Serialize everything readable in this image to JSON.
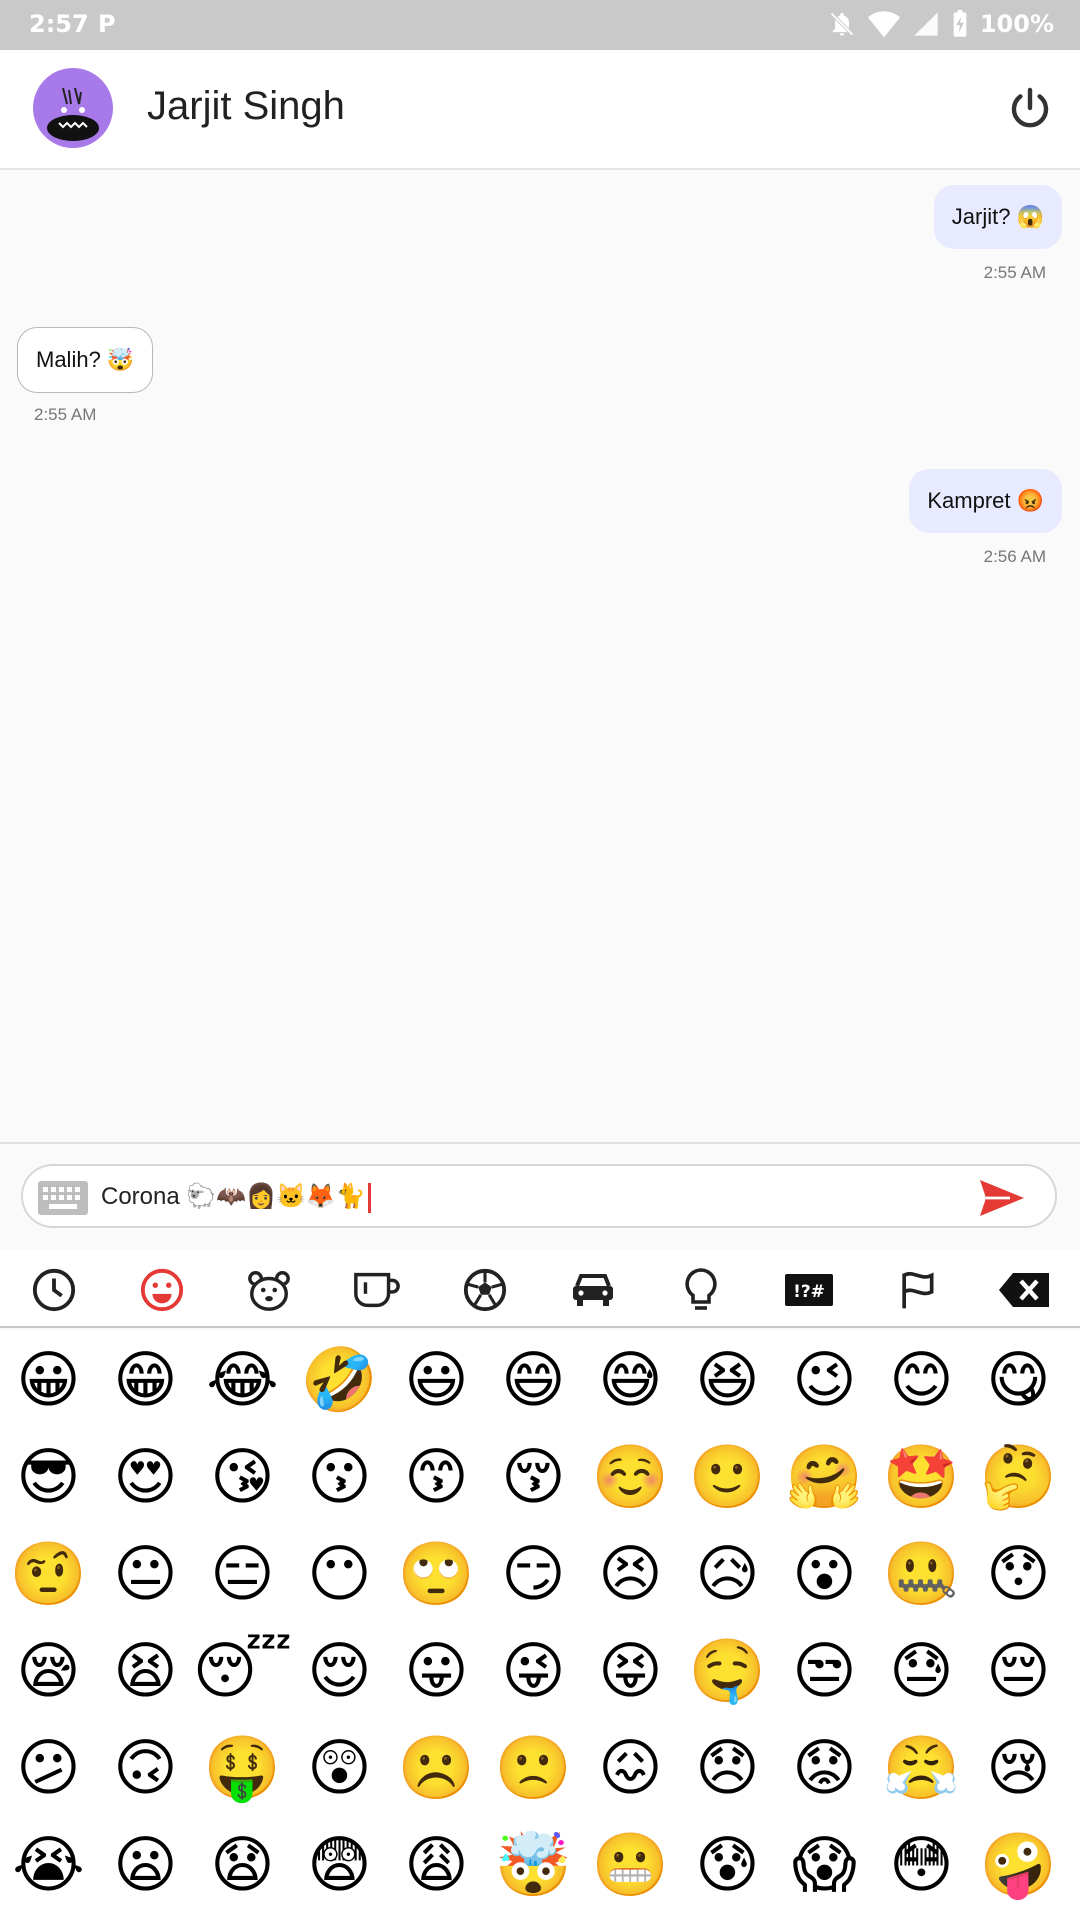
{
  "status_bar": {
    "time": "2:57",
    "battery": "100%"
  },
  "header": {
    "title": "Jarjit Singh"
  },
  "messages": [
    {
      "dir": "out",
      "text": "Jarjit? 😱",
      "time": "2:55 AM"
    },
    {
      "dir": "in",
      "text": "Malih? 🤯",
      "time": "2:55 AM"
    },
    {
      "dir": "out",
      "text": "Kampret 😡",
      "time": "2:56 AM"
    }
  ],
  "composer": {
    "text": "Corona 🐑🦇👩🐱🦊🐈"
  },
  "emoji_tabs": [
    "recent-icon",
    "smileys-icon",
    "animals-icon",
    "food-icon",
    "activity-icon",
    "travel-icon",
    "objects-icon",
    "symbols-icon",
    "flags-icon",
    "backspace-icon"
  ],
  "colors": {
    "accent": "#e53935",
    "avatar": "#a779e9",
    "out_bubble": "#e8eaff"
  },
  "emoji_grid": [
    [
      "😀",
      "😁",
      "😂",
      "🤣",
      "😃",
      "😄",
      "😅",
      "😆",
      "😉",
      "😊",
      "😋"
    ],
    [
      "😎",
      "😍",
      "😘",
      "😗",
      "😙",
      "😚",
      "☺️",
      "🙂",
      "🤗",
      "🤩",
      "🤔"
    ],
    [
      "🤨",
      "😐",
      "😑",
      "😶",
      "🙄",
      "😏",
      "😣",
      "😥",
      "😮",
      "🤐",
      "😯"
    ],
    [
      "😪",
      "😫",
      "😴",
      "😌",
      "😛",
      "😜",
      "😝",
      "🤤",
      "😒",
      "😓",
      "😔"
    ],
    [
      "😕",
      "🙃",
      "🤑",
      "😲",
      "☹️",
      "🙁",
      "😖",
      "😞",
      "😟",
      "😤",
      "😢"
    ],
    [
      "😭",
      "😦",
      "😧",
      "😨",
      "😩",
      "🤯",
      "😬",
      "😰",
      "😱",
      "😳",
      "🤪"
    ]
  ]
}
